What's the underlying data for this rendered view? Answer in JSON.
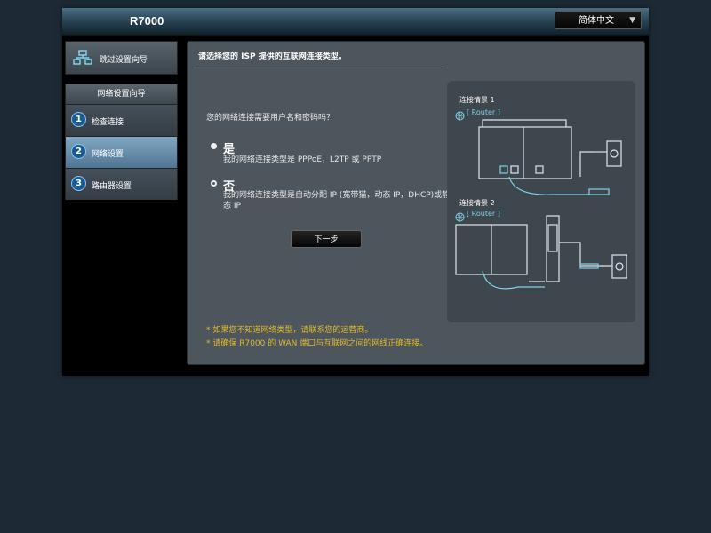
{
  "header": {
    "model": "R7000",
    "language": "简体中文"
  },
  "sidebar": {
    "skip_wizard": "跳过设置向导",
    "wizard_title": "网络设置向导",
    "steps": [
      {
        "num": "1",
        "label": "检查连接"
      },
      {
        "num": "2",
        "label": "网络设置"
      },
      {
        "num": "3",
        "label": "路由器设置"
      }
    ]
  },
  "main": {
    "title": "请选择您的 ISP 提供的互联网连接类型。",
    "question": "您的网络连接需要用户名和密码吗？",
    "options": [
      {
        "label": "是",
        "desc": "我的网络连接类型是 PPPoE，L2TP 或 PPTP",
        "selected": true
      },
      {
        "label": "否",
        "desc": "我的网络连接类型是自动分配 IP (宽带猫，动态 IP，DHCP)或静态 IP",
        "selected": false
      }
    ],
    "next": "下一步",
    "notes": [
      "* 如果您不知道网络类型，请联系您的运营商。",
      "* 请确保 R7000 的 WAN 端口与互联网之间的网线正确连接。"
    ]
  },
  "diagram": {
    "scenario1": "连接情景 1",
    "scenario2": "连接情景 2",
    "router_tag": "[ Router ]"
  },
  "colors": {
    "background": "#1d2a36",
    "panel": "#4e565d",
    "note": "#e0b92a",
    "accent": "#7fd3e8"
  }
}
